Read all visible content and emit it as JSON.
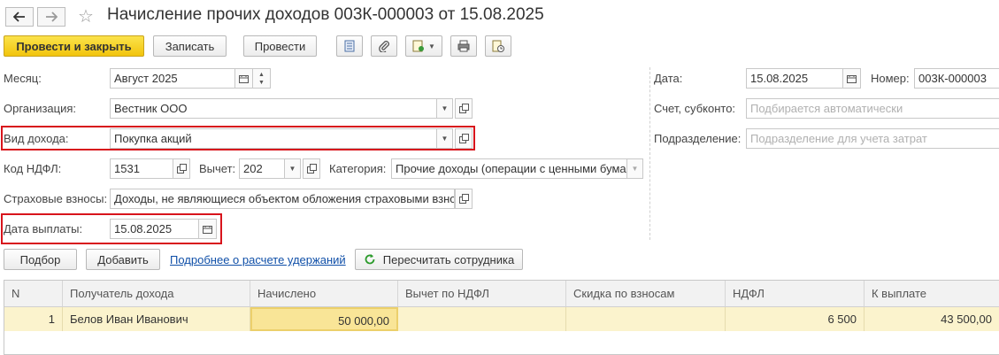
{
  "window": {
    "title": "Начисление прочих доходов 003К-000003 от 15.08.2025"
  },
  "toolbar": {
    "post_close": "Провести и закрыть",
    "save": "Записать",
    "post": "Провести"
  },
  "form": {
    "month": {
      "label": "Месяц:",
      "value": "Август 2025"
    },
    "organization": {
      "label": "Организация:",
      "value": "Вестник ООО"
    },
    "income_type": {
      "label": "Вид дохода:",
      "value": "Покупка акций"
    },
    "ndfl_code": {
      "label": "Код НДФЛ:",
      "value": "1531"
    },
    "deduction": {
      "label": "Вычет:",
      "value": "202"
    },
    "category": {
      "label": "Категория:",
      "value": "Прочие доходы (операции с ценными бума"
    },
    "insurance": {
      "label": "Страховые взносы:",
      "value": "Доходы, не являющиеся объектом обложения страховыми взно"
    },
    "pay_date": {
      "label": "Дата выплаты:",
      "value": "15.08.2025"
    },
    "date": {
      "label": "Дата:",
      "value": "15.08.2025"
    },
    "number": {
      "label": "Номер:",
      "value": "003К-000003"
    },
    "account": {
      "label": "Счет, субконто:",
      "placeholder": "Подбирается автоматически"
    },
    "division": {
      "label": "Подразделение:",
      "placeholder": "Подразделение для учета затрат"
    }
  },
  "actions": {
    "select": "Подбор",
    "add": "Добавить",
    "details_link": "Подробнее о расчете удержаний",
    "recalc": "Пересчитать сотрудника"
  },
  "table": {
    "columns": [
      "N",
      "Получатель дохода",
      "Начислено",
      "Вычет по НДФЛ",
      "Скидка по взносам",
      "НДФЛ",
      "К выплате"
    ],
    "rows": [
      {
        "n": "1",
        "recipient": "Белов Иван Иванович",
        "accrued": "50 000,00",
        "deduction": "",
        "discount": "",
        "ndfl": "6 500",
        "payout": "43 500,00"
      }
    ]
  },
  "colors": {
    "accent": "#f5cf1f",
    "highlight": "#d8141c",
    "row_selected": "#fbf3cd"
  }
}
